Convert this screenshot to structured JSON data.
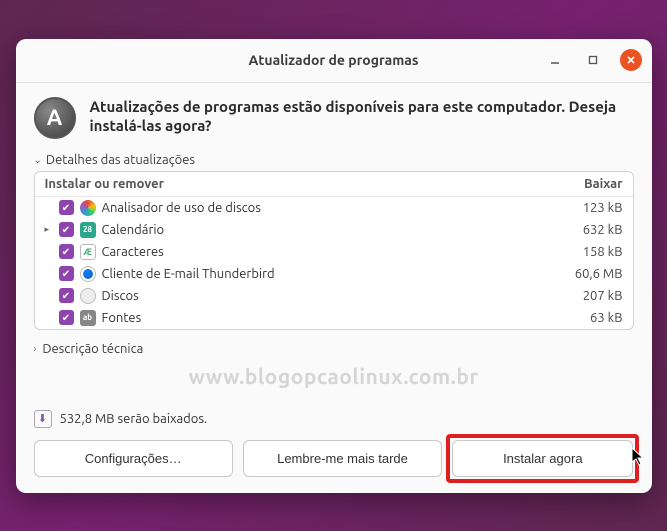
{
  "titlebar": {
    "title": "Atualizador de programas"
  },
  "header": {
    "icon_letter": "A",
    "text": "Atualizações de programas estão disponíveis para este computador. Deseja instalá-las agora?"
  },
  "details": {
    "toggle_label": "Detalhes das atualizações",
    "col_install": "Instalar ou remover",
    "col_size": "Baixar",
    "items": [
      {
        "name": "Analisador de uso de discos",
        "size": "123 kB",
        "expandable": false,
        "cal": ""
      },
      {
        "name": "Calendário",
        "size": "632 kB",
        "expandable": true,
        "cal": "28"
      },
      {
        "name": "Caracteres",
        "size": "158 kB",
        "expandable": false,
        "cal": "Æ"
      },
      {
        "name": "Cliente de E-mail Thunderbird",
        "size": "60,6 MB",
        "expandable": false,
        "cal": ""
      },
      {
        "name": "Discos",
        "size": "207 kB",
        "expandable": false,
        "cal": ""
      },
      {
        "name": "Fontes",
        "size": "63 kB",
        "expandable": false,
        "cal": "ab"
      }
    ]
  },
  "tech_desc": {
    "label": "Descrição técnica"
  },
  "watermark": "www.blogopcaolinux.com.br",
  "status": {
    "text": "532,8 MB serão baixados."
  },
  "buttons": {
    "settings": "Configurações…",
    "later": "Lembre-me mais tarde",
    "install": "Instalar agora"
  }
}
